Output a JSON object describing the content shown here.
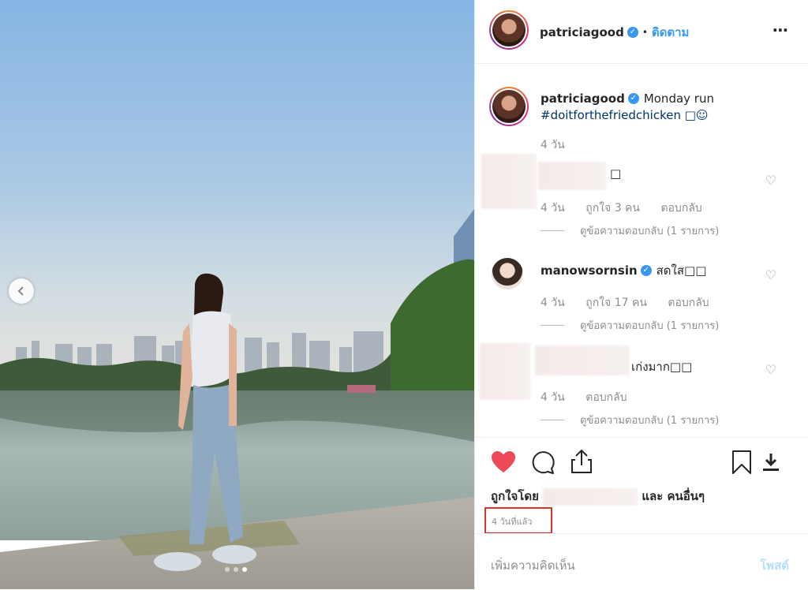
{
  "post": {
    "username": "patriciagood",
    "follow_label": "ติดตาม",
    "dot_sep": "•",
    "more_icon": "⋯",
    "caption_line1": "Monday run",
    "caption_line2": "#doitforthefriedchicken □☺",
    "caption_time": "4 วัน"
  },
  "comments": [
    {
      "text": "□",
      "time": "4 วัน",
      "likes": "ถูกใจ 3 คน",
      "reply": "ตอบกลับ",
      "view_replies": "ดูข้อความตอบกลับ (1 รายการ)"
    },
    {
      "username": "manowsornsin",
      "text": "สดใส□□",
      "time": "4 วัน",
      "likes": "ถูกใจ 17 คน",
      "reply": "ตอบกลับ",
      "view_replies": "ดูข้อความตอบกลับ (1 รายการ)"
    },
    {
      "text": "เก่งมาก□□",
      "time": "4 วัน",
      "reply": "ตอบกลับ",
      "view_replies": "ดูข้อความตอบกลับ (1 รายการ)"
    }
  ],
  "actions": {
    "liked_by_prefix": "ถูกใจโดย",
    "liked_by_suffix": "และ คนอื่นๆ",
    "timestamp": "4 วันที่แล้ว",
    "like_color": "#ed4956",
    "highlight_color": "#e0302b"
  },
  "add_comment": {
    "placeholder": "เพิ่มความคิดเห็น",
    "post_label": "โพสต์"
  },
  "carousel": {
    "slide_count": 3,
    "active_slide": 2
  }
}
